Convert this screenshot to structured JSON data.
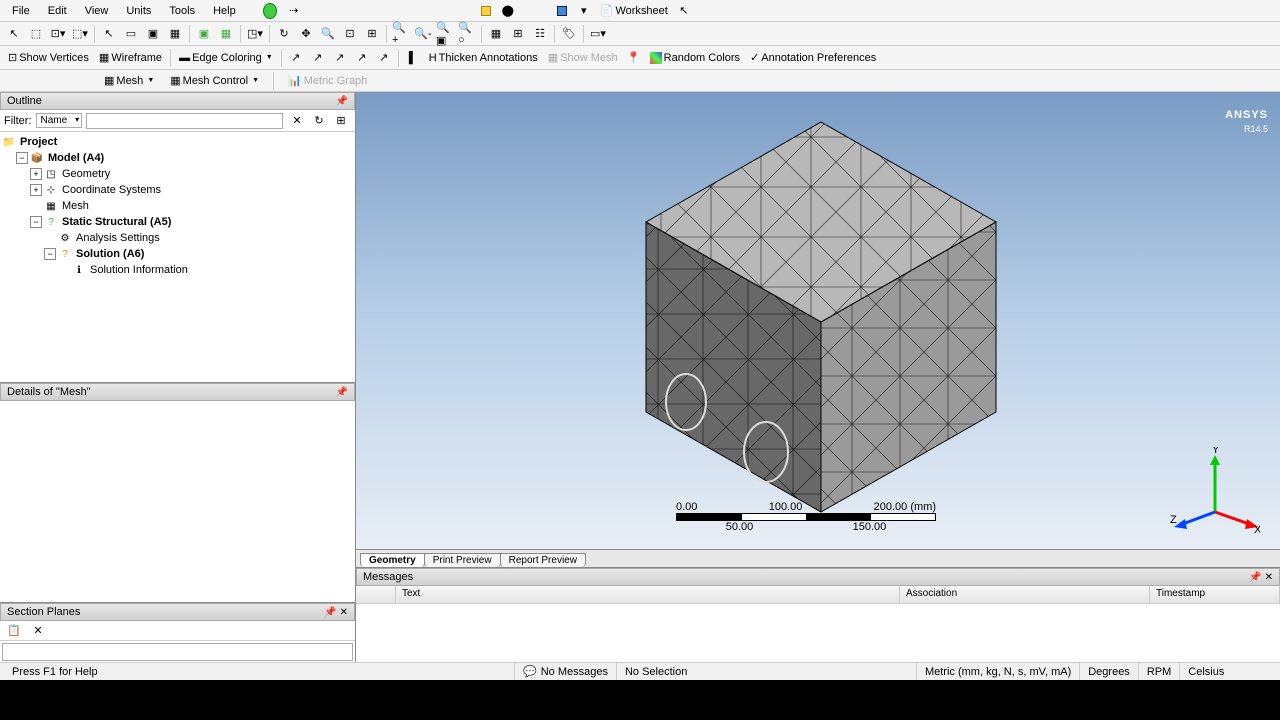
{
  "menu": {
    "file": "File",
    "edit": "Edit",
    "view": "View",
    "units": "Units",
    "tools": "Tools",
    "help": "Help",
    "worksheet": "Worksheet"
  },
  "toolbar2": {
    "show_vertices": "Show Vertices",
    "wireframe": "Wireframe",
    "edge_coloring": "Edge Coloring",
    "thicken_annotations": "Thicken Annotations",
    "show_mesh": "Show Mesh",
    "random_colors": "Random Colors",
    "annotation_prefs": "Annotation Preferences"
  },
  "toolbar3": {
    "mesh": "Mesh",
    "mesh_control": "Mesh Control",
    "metric_graph": "Metric Graph"
  },
  "outline": {
    "title": "Outline",
    "filter_label": "Filter:",
    "filter_type": "Name",
    "tree": {
      "project": "Project",
      "model": "Model (A4)",
      "geometry": "Geometry",
      "coord": "Coordinate Systems",
      "mesh": "Mesh",
      "static": "Static Structural (A5)",
      "analysis": "Analysis Settings",
      "solution": "Solution (A6)",
      "solinfo": "Solution Information"
    }
  },
  "details": {
    "title": "Details of \"Mesh\""
  },
  "section_planes": {
    "title": "Section Planes"
  },
  "viewport": {
    "logo": "ANSYS",
    "version": "R14.5",
    "scale": {
      "s0": "0.00",
      "s100": "100.00",
      "s200": "200.00 (mm)",
      "s50": "50.00",
      "s150": "150.00"
    },
    "triad": {
      "x": "X",
      "y": "Y",
      "z": "Z"
    }
  },
  "view_tabs": {
    "geometry": "Geometry",
    "print_preview": "Print Preview",
    "report_preview": "Report Preview"
  },
  "messages": {
    "title": "Messages",
    "col_text": "Text",
    "col_assoc": "Association",
    "col_ts": "Timestamp"
  },
  "status": {
    "help": "Press F1 for Help",
    "no_messages": "No Messages",
    "no_selection": "No Selection",
    "units": "Metric (mm, kg, N, s, mV, mA)",
    "degrees": "Degrees",
    "rpm": "RPM",
    "celsius": "Celsius"
  }
}
